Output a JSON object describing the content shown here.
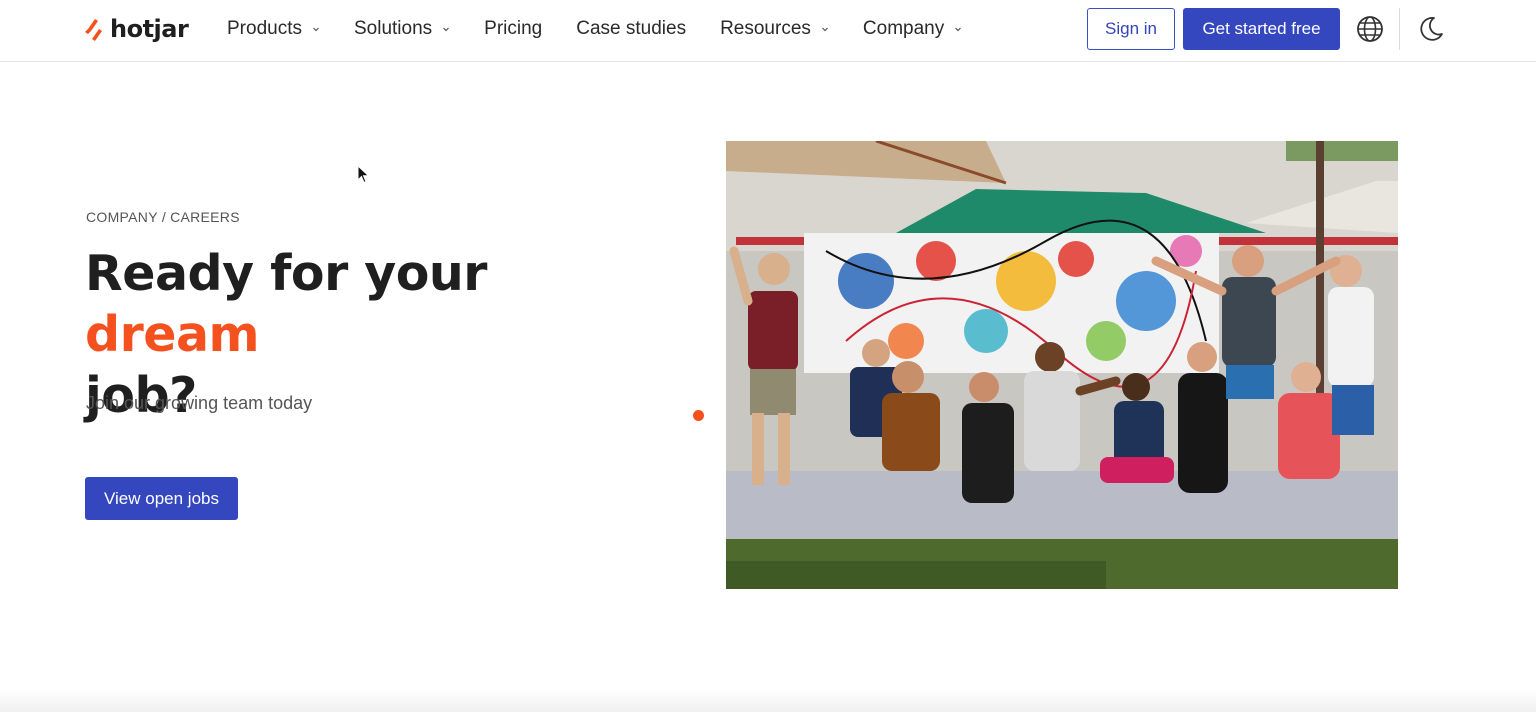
{
  "brand": {
    "name": "hotjar",
    "accent_color": "#f4511e",
    "primary_color": "#3547bf"
  },
  "nav": {
    "items": [
      {
        "label": "Products",
        "has_dropdown": true
      },
      {
        "label": "Solutions",
        "has_dropdown": true
      },
      {
        "label": "Pricing",
        "has_dropdown": false
      },
      {
        "label": "Case studies",
        "has_dropdown": false
      },
      {
        "label": "Resources",
        "has_dropdown": true
      },
      {
        "label": "Company",
        "has_dropdown": true
      }
    ],
    "sign_in": "Sign in",
    "get_started": "Get started free",
    "icons": [
      "globe-icon",
      "moon-icon"
    ]
  },
  "hero": {
    "breadcrumb": [
      "COMPANY",
      "/",
      "CAREERS"
    ],
    "title_part1": "Ready for your ",
    "title_accent": "dream",
    "title_part2": "job?",
    "subtitle": "Join our growing team today",
    "cta": "View open jobs"
  }
}
